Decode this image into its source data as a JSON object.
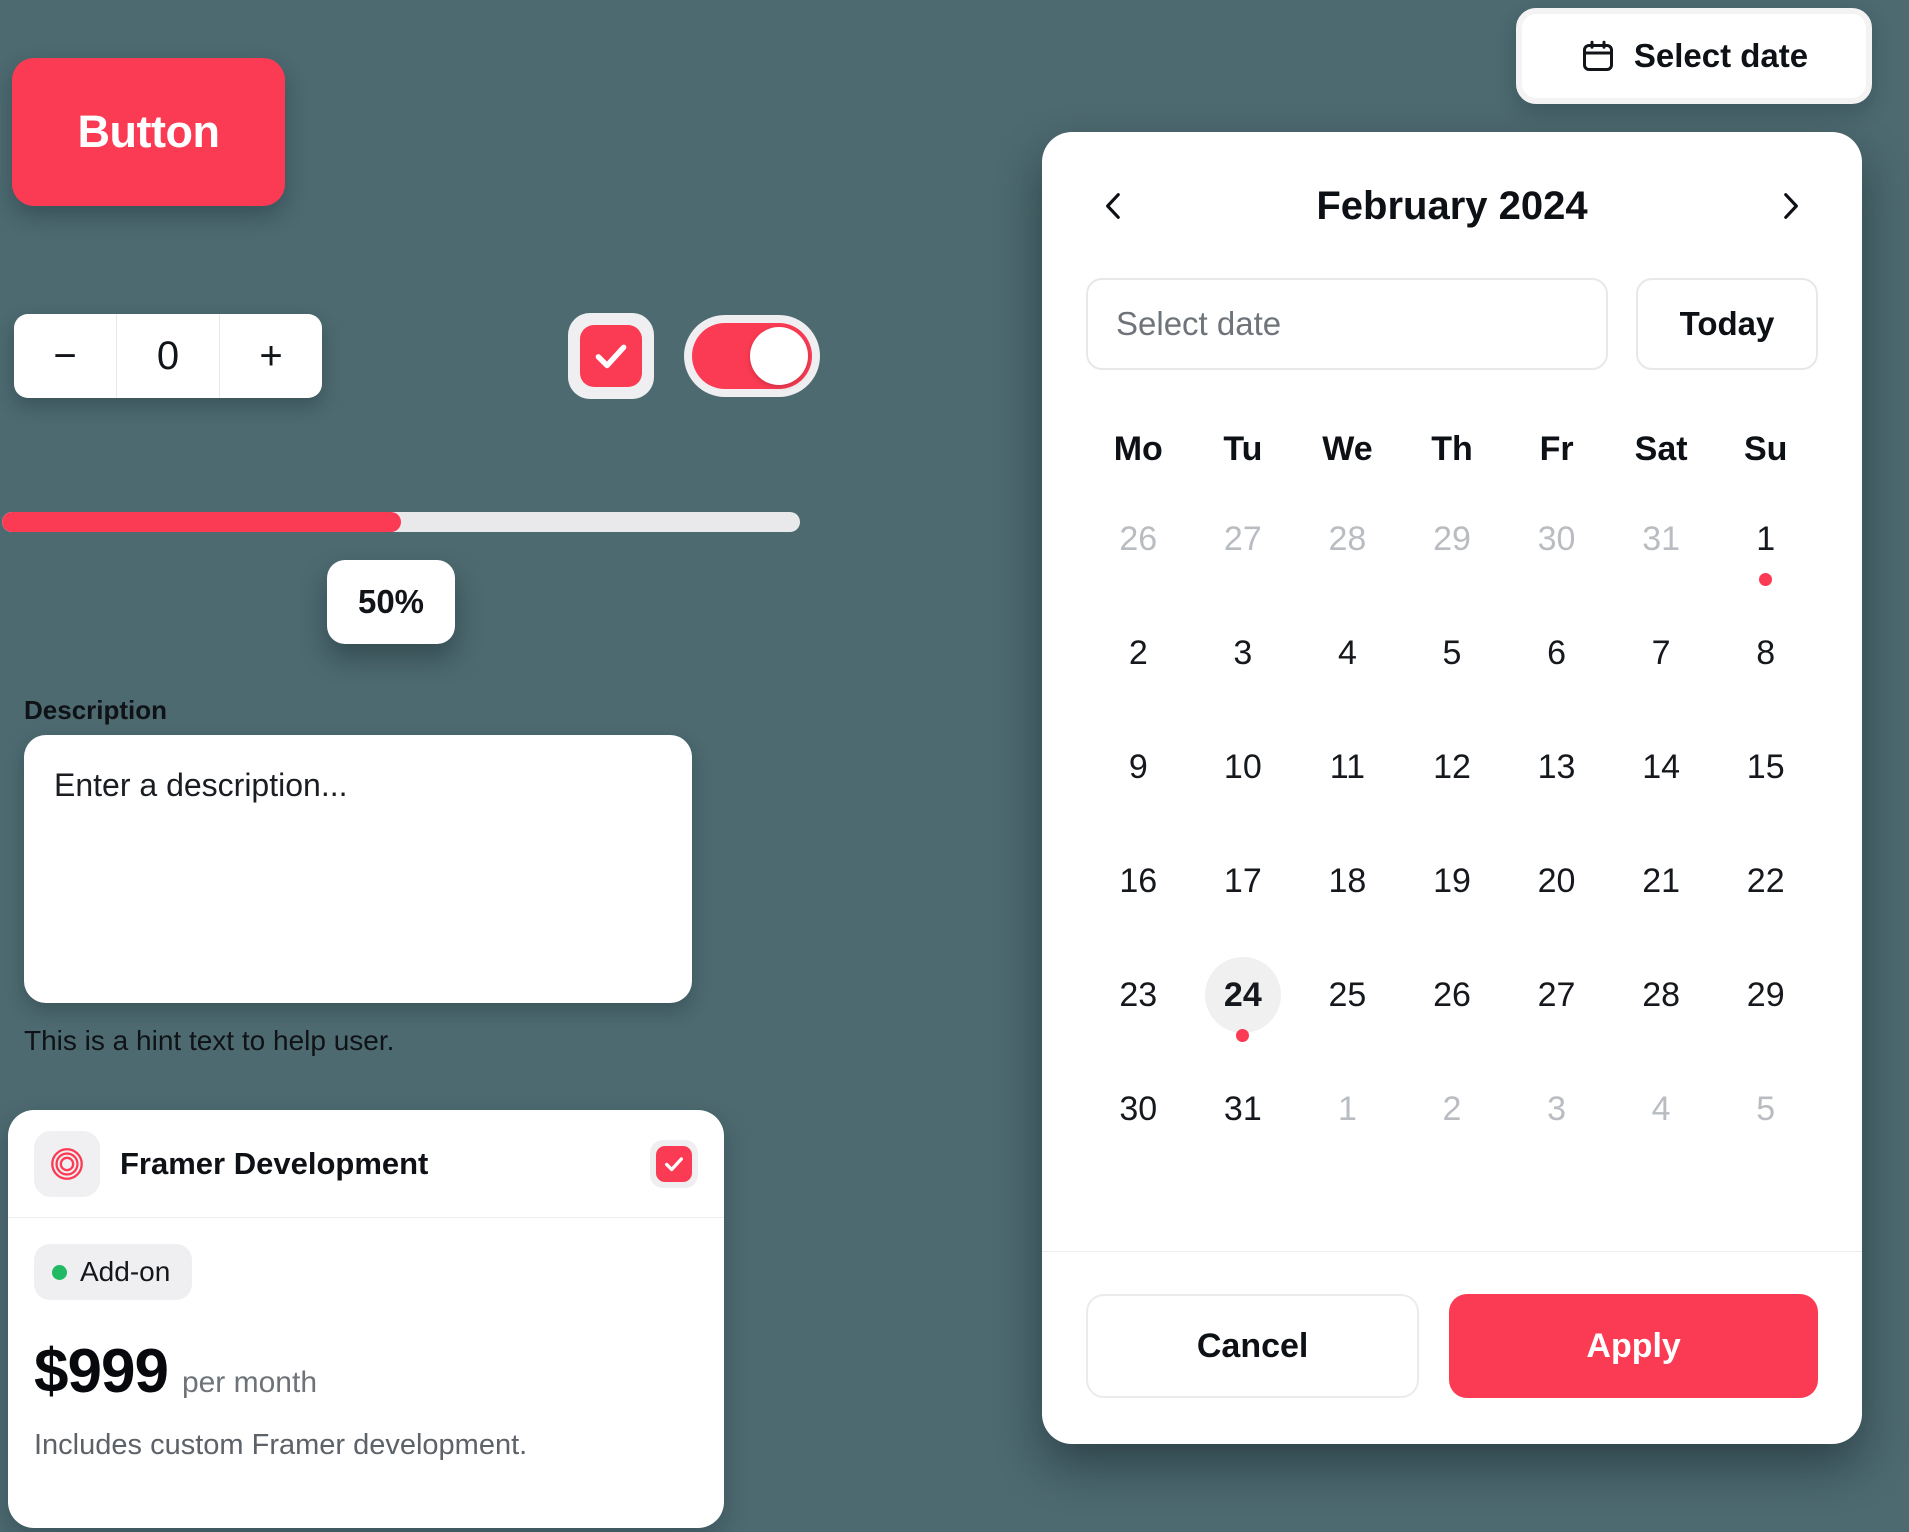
{
  "theme": {
    "background": "#4d6a70",
    "accent": "#FB3B53",
    "surface": "#ffffff",
    "muted_text": "#b9bdc2",
    "badge_dot": "#22b964"
  },
  "left_panel": {
    "primary_button": {
      "label": "Button"
    },
    "stepper": {
      "decrement_label": "−",
      "value": "0",
      "increment_label": "+"
    },
    "checkbox": {
      "checked": true,
      "icon": "check-icon"
    },
    "toggle": {
      "state": "on"
    },
    "slider": {
      "value_label": "50%",
      "percent": 50,
      "min": 0,
      "max": 100
    },
    "description_field": {
      "label": "Description",
      "placeholder": "Enter a description...",
      "value": "",
      "hint": "This is a hint text to help user."
    },
    "pricing_card": {
      "icon": "concentric-rings-icon",
      "title": "Framer Development",
      "checked": true,
      "badge": "Add-on",
      "price": "$999",
      "period": "per month",
      "description": "Includes custom Framer development."
    }
  },
  "date_picker": {
    "trigger": {
      "icon": "calendar-icon",
      "label": "Select date"
    },
    "prev_icon": "chevron-left-icon",
    "next_icon": "chevron-right-icon",
    "month_title": "February 2024",
    "date_input": {
      "placeholder": "Select date",
      "value": ""
    },
    "today_button": "Today",
    "weekdays": [
      "Mo",
      "Tu",
      "We",
      "Th",
      "Fr",
      "Sat",
      "Su"
    ],
    "weeks": [
      [
        {
          "day": "26",
          "muted": true
        },
        {
          "day": "27",
          "muted": true
        },
        {
          "day": "28",
          "muted": true
        },
        {
          "day": "29",
          "muted": true
        },
        {
          "day": "30",
          "muted": true
        },
        {
          "day": "31",
          "muted": true
        },
        {
          "day": "1",
          "muted": false,
          "dot": true
        }
      ],
      [
        {
          "day": "2"
        },
        {
          "day": "3"
        },
        {
          "day": "4"
        },
        {
          "day": "5"
        },
        {
          "day": "6"
        },
        {
          "day": "7"
        },
        {
          "day": "8"
        }
      ],
      [
        {
          "day": "9"
        },
        {
          "day": "10"
        },
        {
          "day": "11"
        },
        {
          "day": "12"
        },
        {
          "day": "13"
        },
        {
          "day": "14"
        },
        {
          "day": "15"
        }
      ],
      [
        {
          "day": "16"
        },
        {
          "day": "17"
        },
        {
          "day": "18"
        },
        {
          "day": "19"
        },
        {
          "day": "20"
        },
        {
          "day": "21"
        },
        {
          "day": "22"
        }
      ],
      [
        {
          "day": "23"
        },
        {
          "day": "24",
          "selected": true,
          "dot": true
        },
        {
          "day": "25"
        },
        {
          "day": "26"
        },
        {
          "day": "27"
        },
        {
          "day": "28"
        },
        {
          "day": "29"
        }
      ],
      [
        {
          "day": "30"
        },
        {
          "day": "31"
        },
        {
          "day": "1",
          "muted": true
        },
        {
          "day": "2",
          "muted": true
        },
        {
          "day": "3",
          "muted": true
        },
        {
          "day": "4",
          "muted": true
        },
        {
          "day": "5",
          "muted": true
        }
      ]
    ],
    "cancel_button": "Cancel",
    "apply_button": "Apply"
  }
}
